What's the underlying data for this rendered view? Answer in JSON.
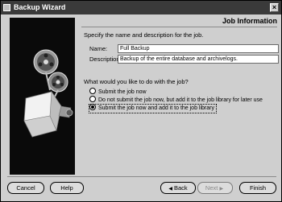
{
  "window": {
    "title": "Backup Wizard",
    "close_glyph": "×"
  },
  "page": {
    "heading": "Job Information",
    "intro": "Specify the name and description for the job."
  },
  "fields": {
    "name_label": "Name:",
    "name_value": "Full Backup",
    "description_label": "Description:",
    "description_value": "Backup of the entire database and archivelogs."
  },
  "options": {
    "question": "What would you like to do with the job?",
    "items": [
      {
        "label": "Submit the job now",
        "selected": false
      },
      {
        "label": "Do not submit the job now, but add it to the job library for later use",
        "selected": false
      },
      {
        "label": "Submit the job now and add it to the job library",
        "selected": true
      }
    ]
  },
  "buttons": {
    "cancel": "Cancel",
    "help": "Help",
    "back": "Back",
    "back_arrow": "◀",
    "next": "Next",
    "next_arrow": "▶",
    "finish": "Finish"
  },
  "icons": {
    "window": "wizard-window-icon",
    "illustration": "film-reels-projector-illustration"
  },
  "colors": {
    "titlebar": "#3a3a3a",
    "window_bg": "#cfcfcf",
    "illustration_bg": "#000000"
  }
}
